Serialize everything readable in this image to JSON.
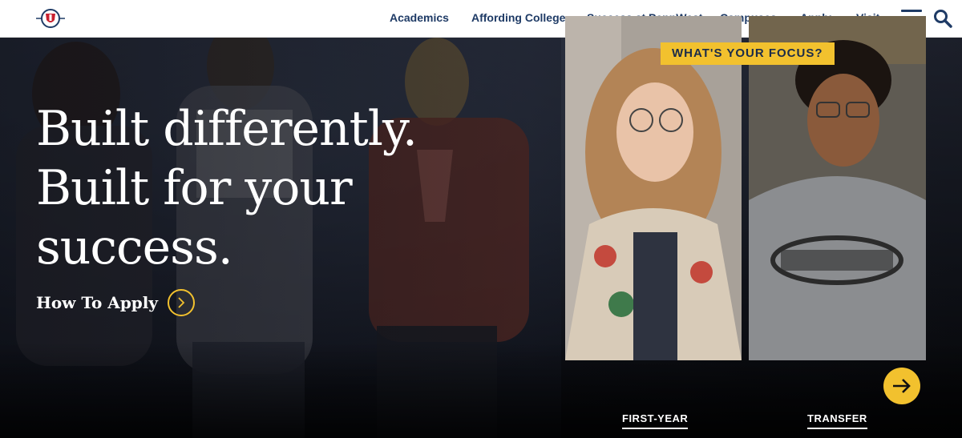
{
  "nav": {
    "items": [
      {
        "label": "Academics"
      },
      {
        "label": "Affording College"
      },
      {
        "label": "Success at PennWest"
      },
      {
        "label": "Campuses"
      },
      {
        "label": "Apply"
      },
      {
        "label": "Visit"
      }
    ],
    "menu_icon": "hamburger-menu-icon",
    "search_icon": "search-icon"
  },
  "hero": {
    "headline": [
      "Built differently.",
      "Built for your",
      "success."
    ],
    "cta_label": "How To Apply",
    "cta_icon": "chevron-right-icon"
  },
  "focus": {
    "tag": "WHAT'S YOUR FOCUS?",
    "cards": [
      {
        "label": "FIRST-YEAR"
      },
      {
        "label": "TRANSFER"
      }
    ],
    "next_icon": "arrow-right-icon"
  },
  "colors": {
    "navy": "#1f3b66",
    "accent_yellow": "#f2c12e",
    "brand_red": "#c8202f"
  }
}
